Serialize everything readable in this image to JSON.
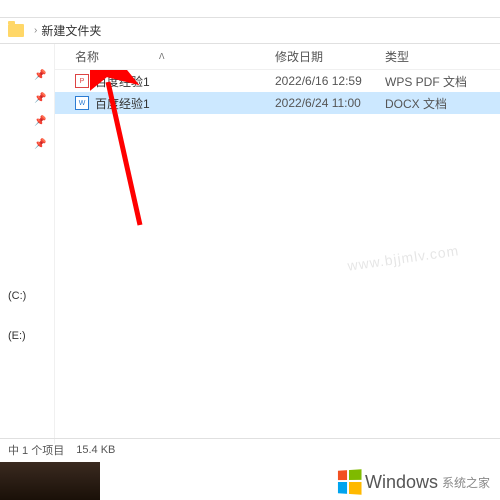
{
  "toolbar": {
    "label1": "",
    "label2": "",
    "label3": "",
    "label4": ""
  },
  "breadcrumb": {
    "folder": "新建文件夹"
  },
  "headers": {
    "name": "名称",
    "date": "修改日期",
    "type": "类型"
  },
  "files": [
    {
      "name": "百度经验1",
      "date": "2022/6/16 12:59",
      "type": "WPS PDF 文档"
    },
    {
      "name": "百度经验1",
      "date": "2022/6/24 11:00",
      "type": "DOCX 文档"
    }
  ],
  "drives": {
    "c": "(C:)",
    "e": "(E:)"
  },
  "status": {
    "selection": "中 1 个项目",
    "size": "15.4 KB"
  },
  "watermark": "www.bjjmlv.com",
  "footer": {
    "brand": "Windows",
    "sub": "系统之家"
  }
}
